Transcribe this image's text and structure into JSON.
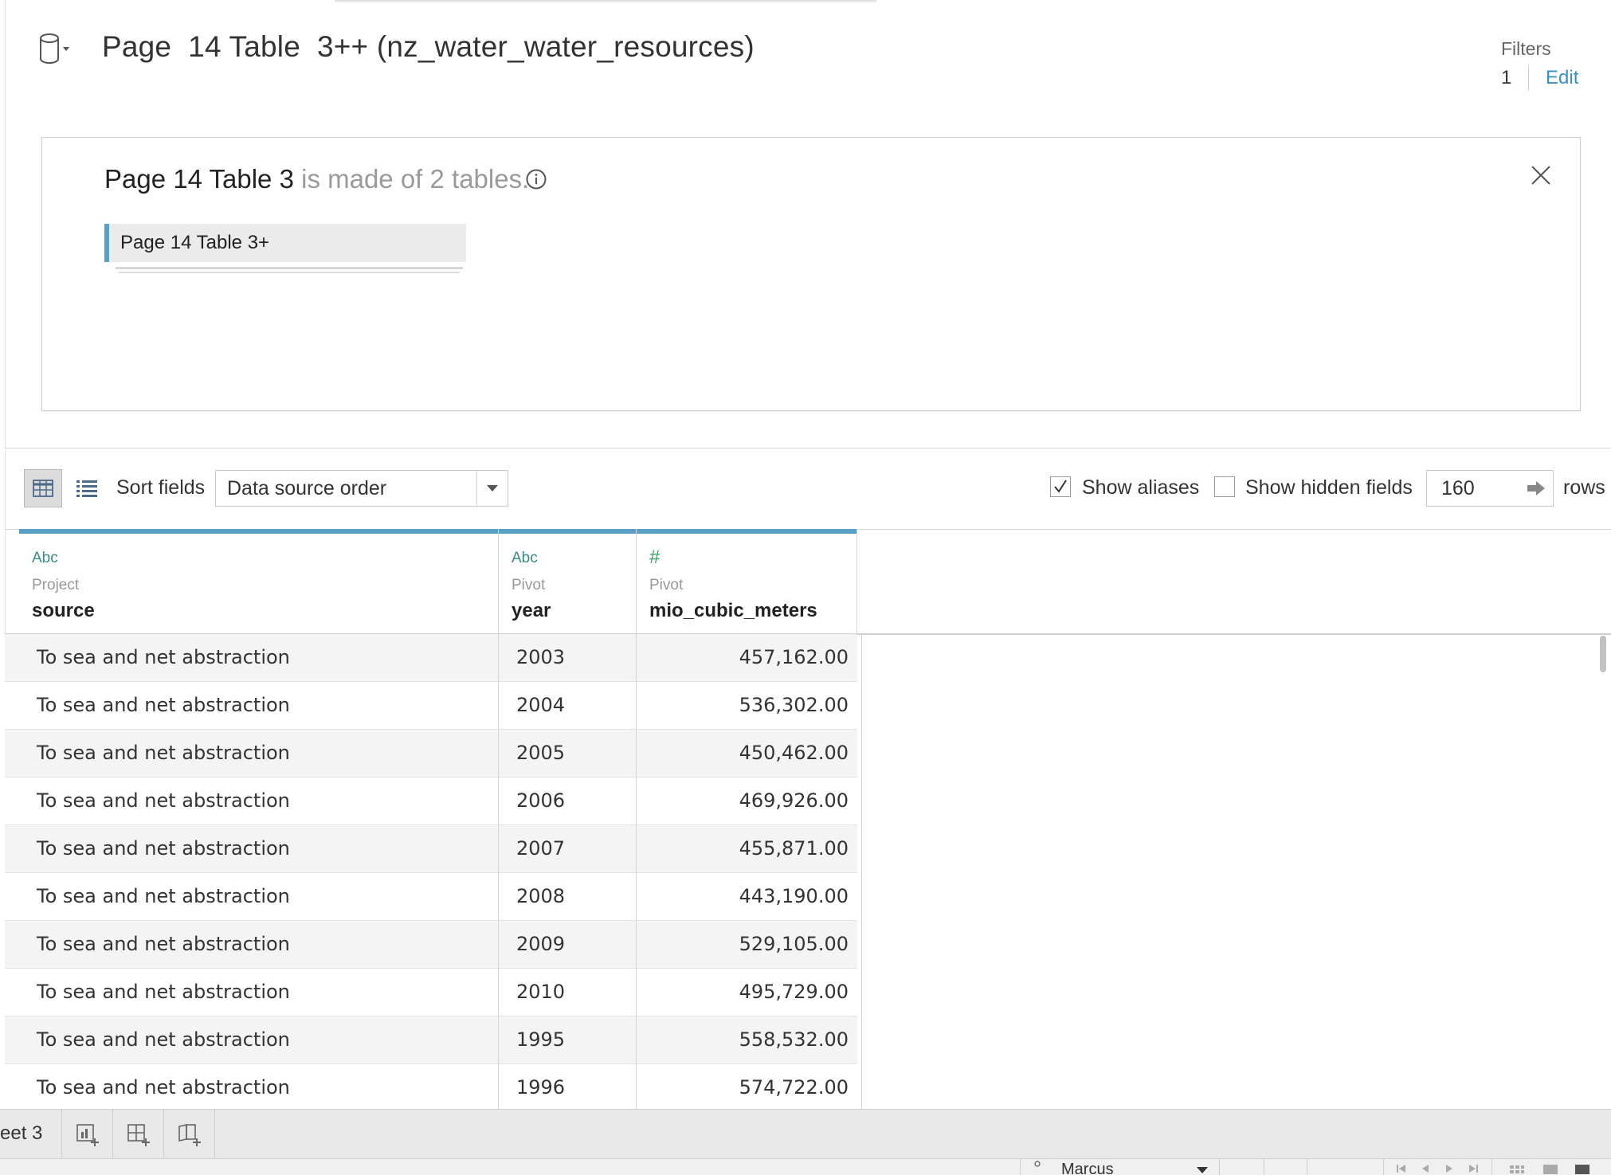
{
  "datasource": {
    "title": "Page  14 Table  3++ (nz_water_water_resources)"
  },
  "filters": {
    "label": "Filters",
    "count": "1",
    "edit_label": "Edit"
  },
  "join_panel": {
    "table_name": "Page 14 Table 3",
    "description": " is made of 2 tables.",
    "chip_label": "Page 14 Table 3+"
  },
  "toolbar": {
    "sort_label": "Sort fields",
    "sort_value": "Data source order",
    "show_aliases_label": "Show aliases",
    "show_aliases_checked": true,
    "show_hidden_label": "Show hidden fields",
    "show_hidden_checked": false,
    "rows_value": "160",
    "rows_label": "rows"
  },
  "columns": [
    {
      "type": "Abc",
      "origin": "Project",
      "name": "source"
    },
    {
      "type": "Abc",
      "origin": "Pivot",
      "name": "year"
    },
    {
      "type": "#",
      "origin": "Pivot",
      "name": "mio_cubic_meters"
    }
  ],
  "rows": [
    {
      "source": "To sea and net abstraction",
      "year": "2003",
      "value": "457,162.00"
    },
    {
      "source": "To sea and net abstraction",
      "year": "2004",
      "value": "536,302.00"
    },
    {
      "source": "To sea and net abstraction",
      "year": "2005",
      "value": "450,462.00"
    },
    {
      "source": "To sea and net abstraction",
      "year": "2006",
      "value": "469,926.00"
    },
    {
      "source": "To sea and net abstraction",
      "year": "2007",
      "value": "455,871.00"
    },
    {
      "source": "To sea and net abstraction",
      "year": "2008",
      "value": "443,190.00"
    },
    {
      "source": "To sea and net abstraction",
      "year": "2009",
      "value": "529,105.00"
    },
    {
      "source": "To sea and net abstraction",
      "year": "2010",
      "value": "495,729.00"
    },
    {
      "source": "To sea and net abstraction",
      "year": "1995",
      "value": "558,532.00"
    },
    {
      "source": "To sea and net abstraction",
      "year": "1996",
      "value": "574,722.00"
    }
  ],
  "sheet_tabs": {
    "current_tab": "eet 3"
  },
  "status": {
    "user": "Marcus"
  },
  "colors": {
    "accent": "#5a9fc5",
    "link": "#3a8fc0",
    "string_type": "#3a8a8a",
    "number_type": "#3aa36a"
  }
}
